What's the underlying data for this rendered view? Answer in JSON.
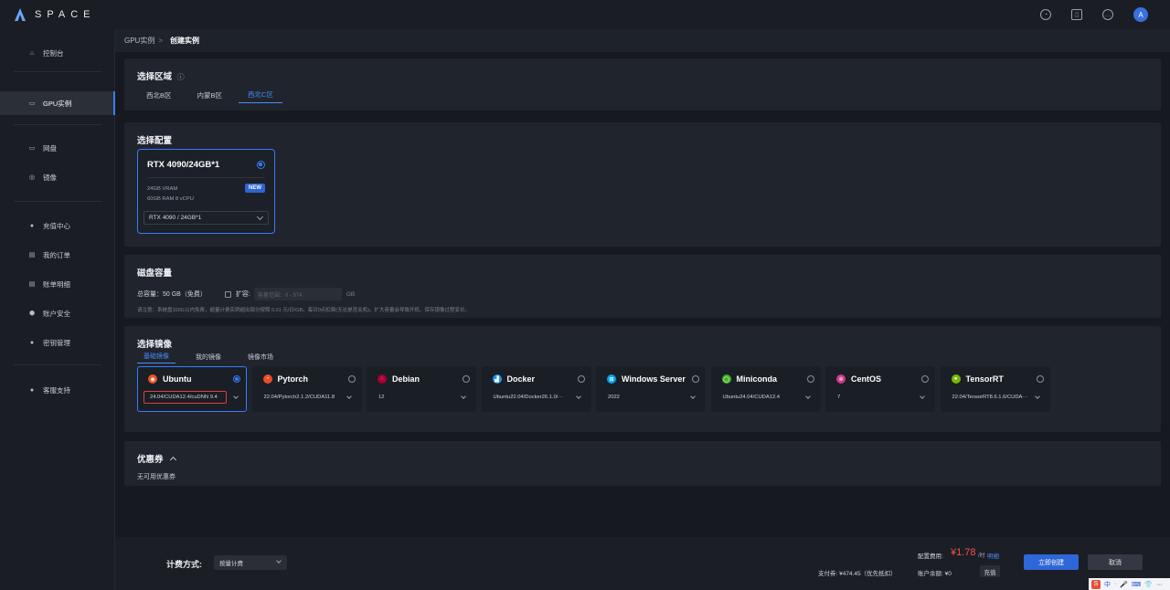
{
  "app": {
    "logo_text": "SPACE",
    "avatar_initial": "A"
  },
  "topbar_icons": [
    "support-icon",
    "book-icon",
    "message-icon"
  ],
  "sidebar": {
    "items": [
      {
        "label": "控制台",
        "icon": "home-icon"
      },
      {
        "label": "GPU实例",
        "icon": "gpu-icon"
      },
      {
        "label": "网盘",
        "icon": "disk-icon"
      },
      {
        "label": "镜像",
        "icon": "image-icon"
      },
      {
        "label": "充值中心",
        "icon": "recharge-icon"
      },
      {
        "label": "我的订单",
        "icon": "order-icon"
      },
      {
        "label": "账单明细",
        "icon": "bill-icon"
      },
      {
        "label": "账户安全",
        "icon": "security-icon"
      },
      {
        "label": "密钥管理",
        "icon": "key-icon"
      },
      {
        "label": "客服支持",
        "icon": "chat-icon"
      }
    ]
  },
  "breadcrumb": {
    "parent": "GPU实例",
    "separator": ">",
    "current": "创建实例"
  },
  "region": {
    "title": "选择区域",
    "info_icon": "ⓘ",
    "tabs": [
      "西北B区",
      "内蒙B区",
      "西北C区"
    ],
    "active": 2
  },
  "config": {
    "title": "选择配置",
    "card": {
      "name": "RTX 4090/24GB*1",
      "vram": "24GB VRAM",
      "ram_cpu": "60GB RAM 8 vCPU",
      "badge": "NEW",
      "selected": "RTX 4090 / 24GB*1"
    }
  },
  "disk": {
    "title": "磁盘容量",
    "total": "总容量：50 GB（免费）",
    "expand_label": "扩容:",
    "expand_placeholder": "容量范围：0 - 974",
    "unit": "GB",
    "note": "请注意：系统盘100G以内免费，超量计费实例超出部分按照 0.01 元/日/GB。每日0点扣费(无论是否关机)。扩大容量会导致开机、保存镜像过程变长。"
  },
  "images": {
    "title": "选择镜像",
    "tabs": [
      "基础镜像",
      "我的镜像",
      "镜像市场"
    ],
    "active_tab": 0,
    "cards": [
      {
        "name": "Ubuntu",
        "version": "24.04/CUDA12.4/cuDNN 9.4",
        "color": "#e95420",
        "glyph": "◉",
        "selected": true
      },
      {
        "name": "Pytorch",
        "version": "22.04/Pytorch2.1.2/CUDA11.8",
        "color": "#ee4c2c",
        "glyph": "◔"
      },
      {
        "name": "Debian",
        "version": "12",
        "color": "#a80030",
        "glyph": "◌"
      },
      {
        "name": "Docker",
        "version": "Ubuntu22.04/Docker26.1.0/···",
        "color": "#2496ed",
        "glyph": "▟"
      },
      {
        "name": "Windows Server",
        "version": "2022",
        "color": "#00a4ef",
        "glyph": "⊞"
      },
      {
        "name": "Miniconda",
        "version": "Ubuntu24.04/CUDA12.4",
        "color": "#43b02a",
        "glyph": "◯"
      },
      {
        "name": "CentOS",
        "version": "7",
        "color": "#cf3a8a",
        "glyph": "✲"
      },
      {
        "name": "TensorRT",
        "version": "22.04/TensorRT8.6.1.6/CUDA···",
        "color": "#76b900",
        "glyph": "●"
      }
    ]
  },
  "coupon": {
    "title": "优惠券",
    "empty": "无可用优惠券"
  },
  "footer": {
    "billing_label": "计费方式:",
    "billing_value": "按量计费",
    "cost_label": "配置费用:",
    "cost_value": "¥1.78",
    "cost_unit": "/时",
    "detail_link": "明细",
    "pay_text": "支付券: ¥474.45（优先抵扣）",
    "balance_text": "账户余额: ¥0",
    "recharge": "充值",
    "create": "立即创建",
    "cancel": "取消"
  },
  "ime": {
    "items": [
      "S",
      "中",
      "·",
      "🎤",
      "⌨",
      "👕",
      "⋯"
    ]
  },
  "colors": {
    "accent": "#3a7bff",
    "danger": "#ff4d4f",
    "bg": "#161920",
    "panel": "#20242c"
  }
}
